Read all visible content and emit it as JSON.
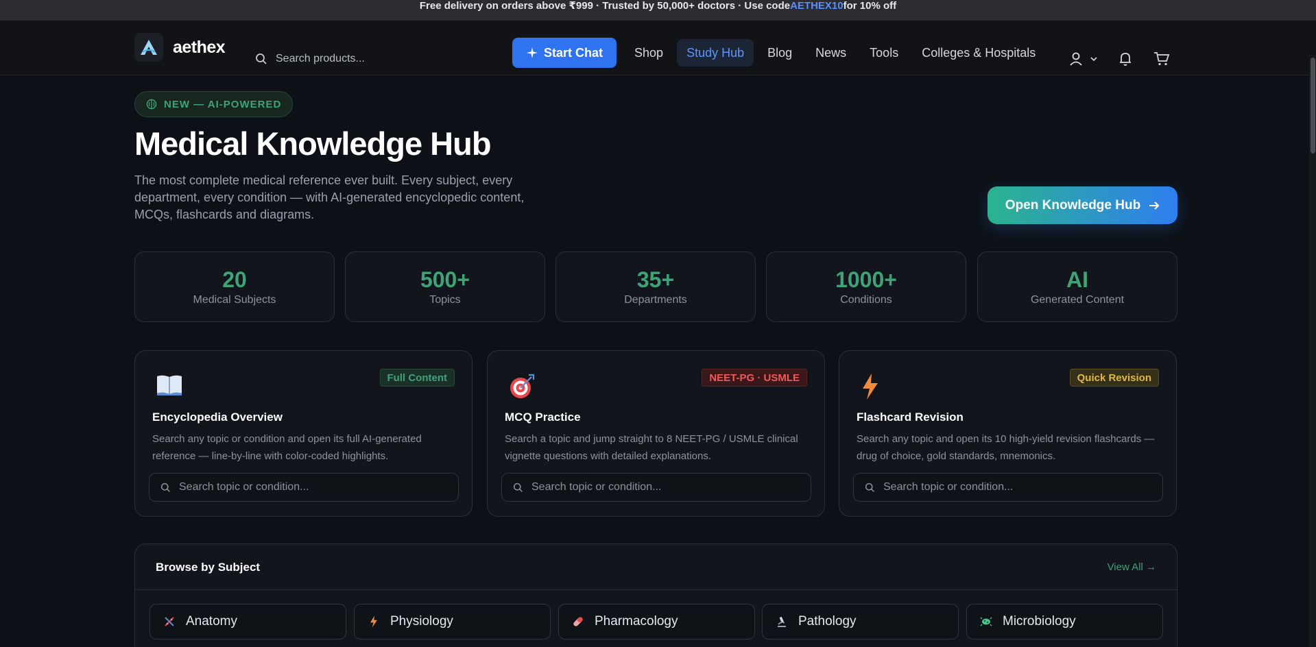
{
  "announcement": {
    "text_before": "Free delivery on orders above ₹999 · Trusted by 50,000+ doctors · Use code ",
    "code": "AETHEX10",
    "text_after": " for 10% off"
  },
  "header": {
    "logo_text": "aethex",
    "search_placeholder": "Search products...",
    "start_chat": "Start Chat",
    "nav": [
      "Shop",
      "Study Hub",
      "Blog",
      "News",
      "Tools",
      "Colleges & Hospitals"
    ],
    "active_nav": "Study Hub"
  },
  "hero": {
    "badge": "NEW — AI-POWERED",
    "title": "Medical Knowledge Hub",
    "description": "The most complete medical reference ever built. Every subject, every department, every condition — with AI-generated encyclopedic content, MCQs, flashcards and diagrams.",
    "cta": "Open Knowledge Hub"
  },
  "stats": [
    {
      "value": "20",
      "label": "Medical Subjects"
    },
    {
      "value": "500+",
      "label": "Topics"
    },
    {
      "value": "35+",
      "label": "Departments"
    },
    {
      "value": "1000+",
      "label": "Conditions"
    },
    {
      "value": "AI",
      "label": "Generated Content"
    }
  ],
  "cards": [
    {
      "icon": "book-icon",
      "tag": "Full Content",
      "title": "Encyclopedia Overview",
      "desc": "Search any topic or condition and open its full AI-generated reference — line-by-line with color-coded highlights.",
      "placeholder": "Search topic or condition..."
    },
    {
      "icon": "target-icon",
      "tag": "NEET-PG · USMLE",
      "title": "MCQ Practice",
      "desc": "Search a topic and jump straight to 8 NEET-PG / USMLE clinical vignette questions with detailed explanations.",
      "placeholder": "Search topic or condition..."
    },
    {
      "icon": "lightning-icon",
      "tag": "Quick Revision",
      "title": "Flashcard Revision",
      "desc": "Search any topic and open its 10 high-yield revision flashcards — drug of choice, gold standards, mnemonics.",
      "placeholder": "Search topic or condition..."
    }
  ],
  "browse": {
    "title": "Browse by Subject",
    "view_all": "View All →",
    "subjects": [
      {
        "icon": "dna-icon",
        "label": "Anatomy"
      },
      {
        "icon": "lightning-icon",
        "label": "Physiology"
      },
      {
        "icon": "pill-icon",
        "label": "Pharmacology"
      },
      {
        "icon": "microscope-icon",
        "label": "Pathology"
      },
      {
        "icon": "microbe-icon",
        "label": "Microbiology"
      }
    ]
  },
  "colors": {
    "accent_blue": "#2f73f0",
    "accent_green": "#3fa378",
    "background": "#0d1117"
  }
}
